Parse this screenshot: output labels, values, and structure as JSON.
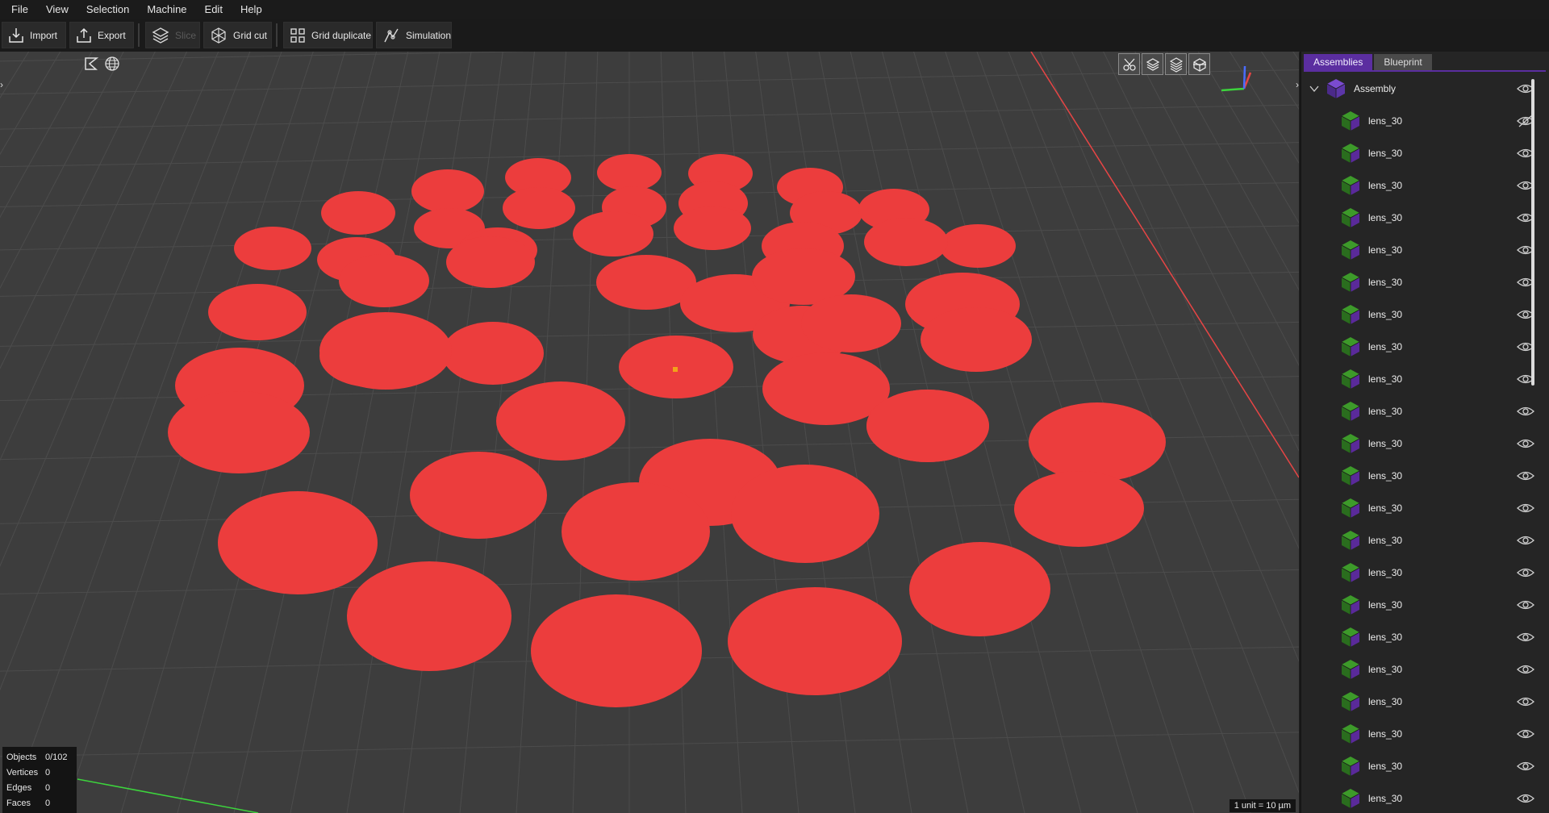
{
  "menu": [
    "File",
    "View",
    "Selection",
    "Machine",
    "Edit",
    "Help"
  ],
  "toolbar": {
    "import": "Import",
    "export": "Export",
    "slice": "Slice",
    "grid_cut": "Grid cut",
    "grid_duplicate": "Grid duplicate",
    "simulation": "Simulation"
  },
  "viewport": {
    "left_edge_arrow": "›",
    "right_edge_arrow": "›",
    "top_left_icons": [
      "perspective-icon",
      "globe-icon"
    ],
    "view_icons": [
      "cut-view-icon",
      "layers-icon",
      "layers-alt-icon",
      "cube-wireframe-icon"
    ],
    "object_color": "#ec3d3d",
    "selection_marker_color": "#f2a21a",
    "stats": [
      {
        "label": "Objects",
        "value": "0/102"
      },
      {
        "label": "Vertices",
        "value": "0"
      },
      {
        "label": "Edges",
        "value": "0"
      },
      {
        "label": "Faces",
        "value": "0"
      }
    ],
    "scale": "1 unit = 10 µm"
  },
  "panel": {
    "tabs": [
      {
        "label": "Assemblies",
        "active": true
      },
      {
        "label": "Blueprint",
        "active": false
      }
    ],
    "root": {
      "label": "Assembly",
      "icon": "assembly-cube-icon"
    },
    "items": [
      {
        "label": "lens_30",
        "hidden": true
      },
      {
        "label": "lens_30",
        "hidden": false
      },
      {
        "label": "lens_30",
        "hidden": false
      },
      {
        "label": "lens_30",
        "hidden": false
      },
      {
        "label": "lens_30",
        "hidden": false
      },
      {
        "label": "lens_30",
        "hidden": false
      },
      {
        "label": "lens_30",
        "hidden": false
      },
      {
        "label": "lens_30",
        "hidden": false
      },
      {
        "label": "lens_30",
        "hidden": false
      },
      {
        "label": "lens_30",
        "hidden": false
      },
      {
        "label": "lens_30",
        "hidden": false
      },
      {
        "label": "lens_30",
        "hidden": false
      },
      {
        "label": "lens_30",
        "hidden": false
      },
      {
        "label": "lens_30",
        "hidden": false
      },
      {
        "label": "lens_30",
        "hidden": false
      },
      {
        "label": "lens_30",
        "hidden": false
      },
      {
        "label": "lens_30",
        "hidden": false
      },
      {
        "label": "lens_30",
        "hidden": false
      },
      {
        "label": "lens_30",
        "hidden": false
      },
      {
        "label": "lens_30",
        "hidden": false
      },
      {
        "label": "lens_30",
        "hidden": false
      },
      {
        "label": "lens_30",
        "hidden": false
      },
      {
        "label": "lens_30",
        "hidden": false
      }
    ]
  }
}
